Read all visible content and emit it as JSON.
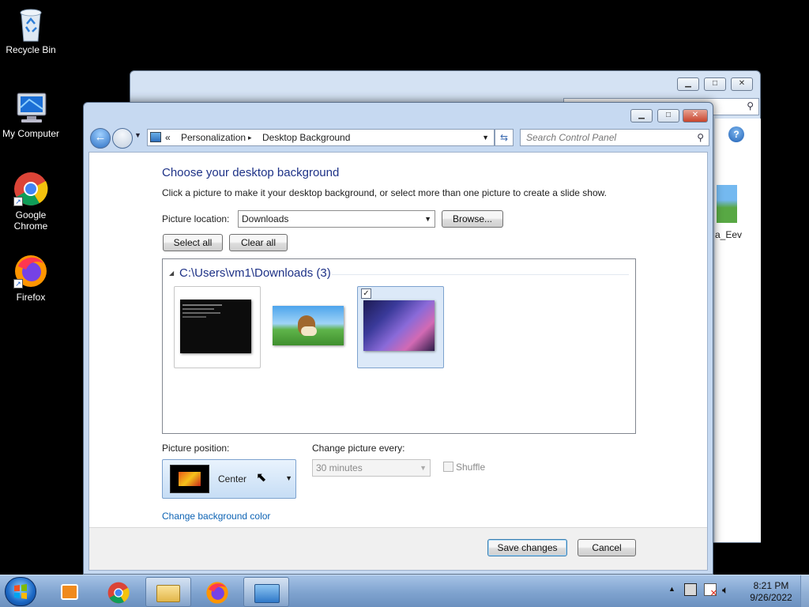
{
  "desktop": {
    "icons": [
      {
        "label": "Recycle Bin"
      },
      {
        "label": "My Computer"
      },
      {
        "label": "Google Chrome"
      },
      {
        "label": "Firefox"
      }
    ],
    "partial_file_label": "a_Eev"
  },
  "window": {
    "address": {
      "chevron": "«",
      "crumbs": [
        "Personalization",
        "Desktop Background"
      ],
      "separator": "▸"
    },
    "search_placeholder": "Search Control Panel",
    "heading": "Choose your desktop background",
    "instruction": "Click a picture to make it your desktop background, or select more than one picture to create a slide show.",
    "picture_location_label": "Picture location:",
    "picture_location_value": "Downloads",
    "browse_label": "Browse...",
    "select_all_label": "Select all",
    "clear_all_label": "Clear all",
    "gallery": {
      "group_title": "C:\\Users\\vm1\\Downloads (3)",
      "thumbnails": [
        {
          "name": "command-prompt-screenshot",
          "checked": false
        },
        {
          "name": "eevee-image",
          "checked": false
        },
        {
          "name": "anime-night-image",
          "checked": true,
          "check_glyph": "✓"
        }
      ]
    },
    "picture_position_label": "Picture position:",
    "picture_position_value": "Center",
    "change_every_label": "Change picture every:",
    "change_every_value": "30 minutes",
    "shuffle_label": "Shuffle",
    "change_bg_color_link": "Change background color",
    "save_label": "Save changes",
    "cancel_label": "Cancel"
  },
  "taskbar": {
    "clock_time": "8:21 PM",
    "clock_date": "9/26/2022",
    "tray_expand": "▲"
  }
}
